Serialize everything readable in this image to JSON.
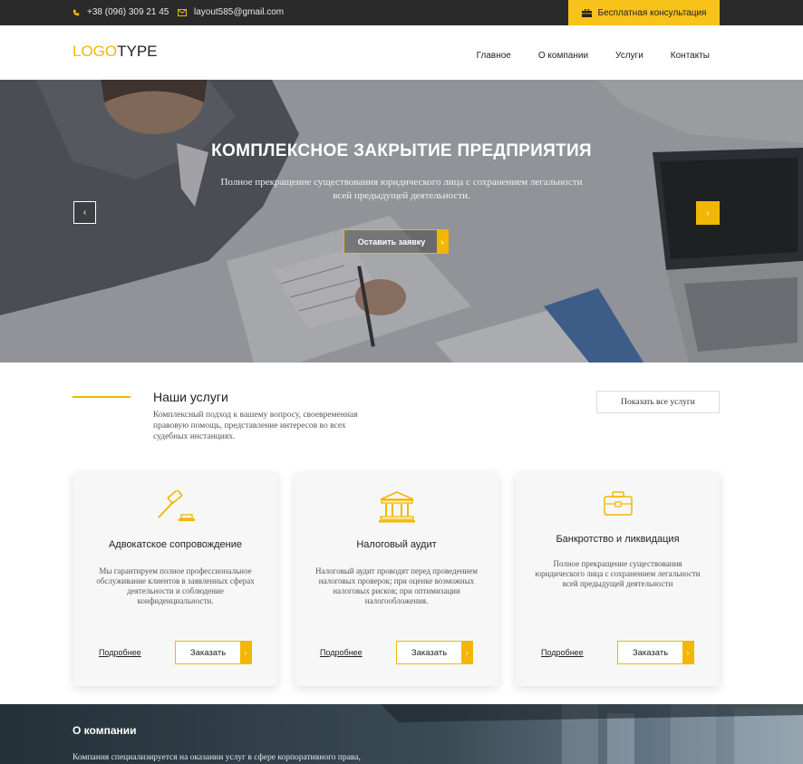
{
  "topbar": {
    "phone": "+38 (096) 309 21 45",
    "email": "layout585@gmail.com",
    "consult_label": "Бесплатная консультация"
  },
  "header": {
    "logo_part1": "LOGO",
    "logo_part2": "TYPE",
    "nav": [
      "Главное",
      "О компании",
      "Услуги",
      "Контакты"
    ]
  },
  "hero": {
    "title": "КОМПЛЕКСНОЕ ЗАКРЫТИЕ ПРЕДПРИЯТИЯ",
    "subtitle": "Полное прекращение существования юридического лица с сохранением легальности всей предыдущей деятельности.",
    "button_label": "Оставить заявку",
    "arrow_left": "‹",
    "arrow_right": "›"
  },
  "services": {
    "title": "Наши услуги",
    "description": "Комплексный подход к вашему вопросу, своевременная правовую помощь, представление интересов во всех судебных инстанциях.",
    "show_all_label": "Показать все услуги",
    "cards": [
      {
        "icon": "gavel-icon",
        "title": "Адвокатское сопровождение",
        "text": "Мы гарантируем полное профессиональное обслуживание клиентов в заявленных сферах деятельности и соблюдение конфиденциальности.",
        "more": "Подробнее",
        "order": "Заказать"
      },
      {
        "icon": "bank-building-icon",
        "title": "Налоговый аудит",
        "text": "Налоговый аудит проводят перед проведением налоговых проверок; при оценке возможных налоговых рисков; при оптимизации налогообложения.",
        "more": "Подробнее",
        "order": "Заказать"
      },
      {
        "icon": "briefcase-icon",
        "title": "Банкротство и ликвидация",
        "text": "Полное прекращение существования юридического лица с сохранением легальности всей предыдущей деятельности",
        "more": "Подробнее",
        "order": "Заказать"
      }
    ]
  },
  "about": {
    "title": "О компании",
    "text": "Компания специализируется на оказании услуг в сфере корпоративного права,"
  },
  "colors": {
    "accent": "#f2b705",
    "topbar": "#2a2a2a",
    "card_bg": "#f7f7f7"
  }
}
